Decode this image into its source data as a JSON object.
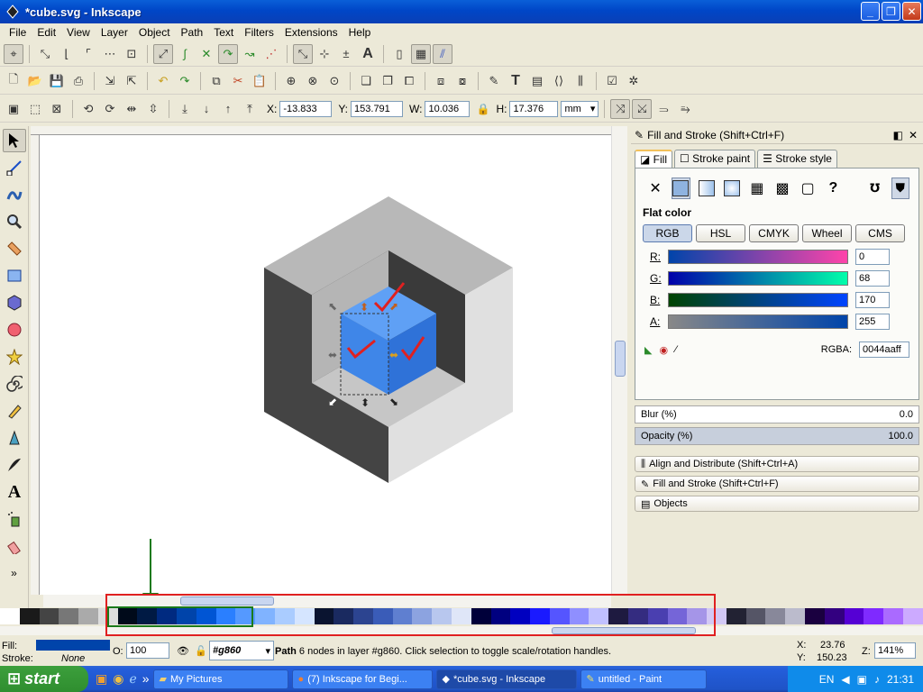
{
  "window": {
    "title": "*cube.svg - Inkscape"
  },
  "menu": [
    "File",
    "Edit",
    "View",
    "Layer",
    "Object",
    "Path",
    "Text",
    "Filters",
    "Extensions",
    "Help"
  ],
  "transform": {
    "x_label": "X:",
    "x": "-13.833",
    "y_label": "Y:",
    "y": "153.791",
    "w_label": "W:",
    "w": "10.036",
    "h_label": "H:",
    "h": "17.376",
    "unit": "mm"
  },
  "panel": {
    "title": "Fill and Stroke (Shift+Ctrl+F)",
    "tabs": [
      "Fill",
      "Stroke paint",
      "Stroke style"
    ],
    "flat_color_label": "Flat color",
    "modes": [
      "RGB",
      "HSL",
      "CMYK",
      "Wheel",
      "CMS"
    ],
    "channels": [
      {
        "label": "R:",
        "value": "0"
      },
      {
        "label": "G:",
        "value": "68"
      },
      {
        "label": "B:",
        "value": "170"
      },
      {
        "label": "A:",
        "value": "255"
      }
    ],
    "rgba_label": "RGBA:",
    "rgba_value": "0044aaff",
    "blur_label": "Blur (%)",
    "blur_value": "0.0",
    "opacity_label": "Opacity (%)",
    "opacity_value": "100.0",
    "docked": [
      "Align and Distribute (Shift+Ctrl+A)",
      "Fill and Stroke (Shift+Ctrl+F)",
      "Objects"
    ]
  },
  "status": {
    "fill_label": "Fill:",
    "stroke_label": "Stroke:",
    "stroke_value": "None",
    "fill_color": "#0044aa",
    "opacity_label": "O:",
    "opacity_value": "100",
    "layer": "#g860",
    "message_bold": "Path",
    "message": "6 nodes in layer #g860. Click selection to toggle scale/rotation handles.",
    "coord_x_label": "X:",
    "coord_x": "23.76",
    "coord_y_label": "Y:",
    "coord_y": "150.23",
    "zoom_label": "Z:",
    "zoom": "141%"
  },
  "taskbar": {
    "start": "start",
    "tasks": [
      "My Pictures",
      "(7) Inkscape for Begi...",
      "*cube.svg - Inkscape",
      "untitled - Paint"
    ],
    "lang": "EN",
    "clock": "21:31"
  },
  "colors": {
    "cube_blue": "#3f86e8",
    "annotation_red": "#e02020",
    "annotation_green": "#1a7a1a"
  }
}
